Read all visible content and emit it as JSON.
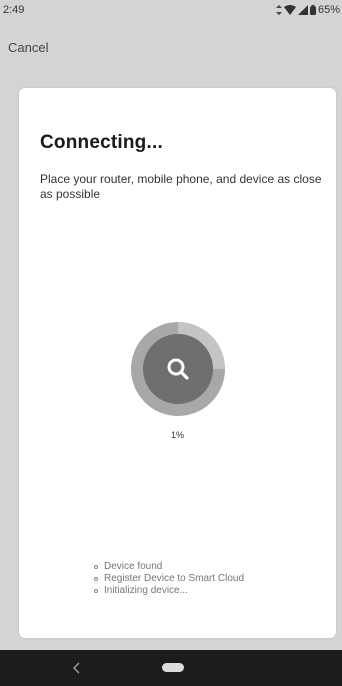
{
  "status_bar": {
    "time": "2:49",
    "battery": "65%"
  },
  "header": {
    "cancel_label": "Cancel"
  },
  "card": {
    "title": "Connecting...",
    "subtitle": "Place your router, mobile phone, and device as close as possible",
    "progress": {
      "percent_label": "1%",
      "value": 0.01
    },
    "steps": [
      {
        "label": "Device found"
      },
      {
        "label": "Register Device to Smart Cloud"
      },
      {
        "label": "Initializing device..."
      }
    ]
  },
  "icons": {
    "search": "search-icon",
    "back": "back-icon",
    "home": "home-pill"
  },
  "colors": {
    "background": "#d4d4d4",
    "card": "#ffffff",
    "nav_bar": "#1c1c1c",
    "spinner_ring": "#a8a8a8",
    "spinner_center": "#6f6f6f"
  }
}
